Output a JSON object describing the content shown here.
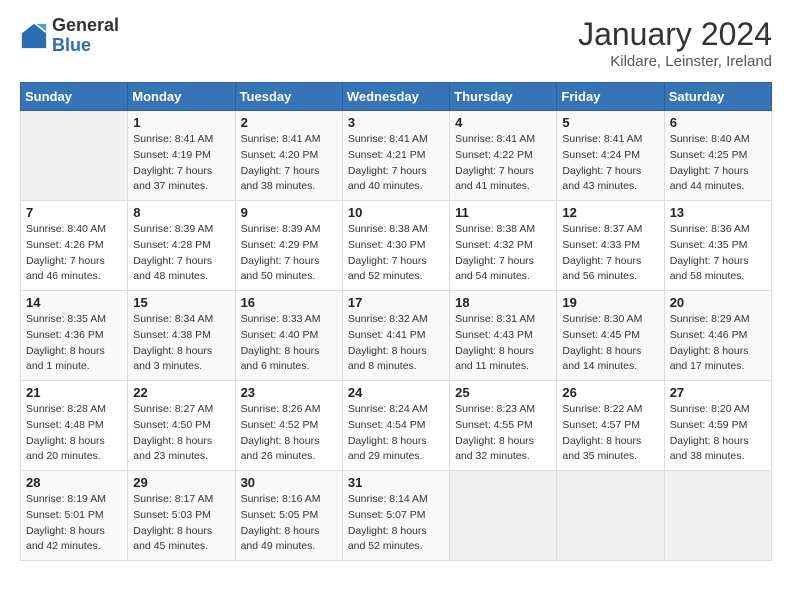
{
  "logo": {
    "general": "General",
    "blue": "Blue"
  },
  "title": "January 2024",
  "location": "Kildare, Leinster, Ireland",
  "days_of_week": [
    "Sunday",
    "Monday",
    "Tuesday",
    "Wednesday",
    "Thursday",
    "Friday",
    "Saturday"
  ],
  "weeks": [
    [
      {
        "day": null
      },
      {
        "day": 1,
        "sunrise": "8:41 AM",
        "sunset": "4:19 PM",
        "daylight": "7 hours and 37 minutes."
      },
      {
        "day": 2,
        "sunrise": "8:41 AM",
        "sunset": "4:20 PM",
        "daylight": "7 hours and 38 minutes."
      },
      {
        "day": 3,
        "sunrise": "8:41 AM",
        "sunset": "4:21 PM",
        "daylight": "7 hours and 40 minutes."
      },
      {
        "day": 4,
        "sunrise": "8:41 AM",
        "sunset": "4:22 PM",
        "daylight": "7 hours and 41 minutes."
      },
      {
        "day": 5,
        "sunrise": "8:41 AM",
        "sunset": "4:24 PM",
        "daylight": "7 hours and 43 minutes."
      },
      {
        "day": 6,
        "sunrise": "8:40 AM",
        "sunset": "4:25 PM",
        "daylight": "7 hours and 44 minutes."
      }
    ],
    [
      {
        "day": 7,
        "sunrise": "8:40 AM",
        "sunset": "4:26 PM",
        "daylight": "7 hours and 46 minutes."
      },
      {
        "day": 8,
        "sunrise": "8:39 AM",
        "sunset": "4:28 PM",
        "daylight": "7 hours and 48 minutes."
      },
      {
        "day": 9,
        "sunrise": "8:39 AM",
        "sunset": "4:29 PM",
        "daylight": "7 hours and 50 minutes."
      },
      {
        "day": 10,
        "sunrise": "8:38 AM",
        "sunset": "4:30 PM",
        "daylight": "7 hours and 52 minutes."
      },
      {
        "day": 11,
        "sunrise": "8:38 AM",
        "sunset": "4:32 PM",
        "daylight": "7 hours and 54 minutes."
      },
      {
        "day": 12,
        "sunrise": "8:37 AM",
        "sunset": "4:33 PM",
        "daylight": "7 hours and 56 minutes."
      },
      {
        "day": 13,
        "sunrise": "8:36 AM",
        "sunset": "4:35 PM",
        "daylight": "7 hours and 58 minutes."
      }
    ],
    [
      {
        "day": 14,
        "sunrise": "8:35 AM",
        "sunset": "4:36 PM",
        "daylight": "8 hours and 1 minute."
      },
      {
        "day": 15,
        "sunrise": "8:34 AM",
        "sunset": "4:38 PM",
        "daylight": "8 hours and 3 minutes."
      },
      {
        "day": 16,
        "sunrise": "8:33 AM",
        "sunset": "4:40 PM",
        "daylight": "8 hours and 6 minutes."
      },
      {
        "day": 17,
        "sunrise": "8:32 AM",
        "sunset": "4:41 PM",
        "daylight": "8 hours and 8 minutes."
      },
      {
        "day": 18,
        "sunrise": "8:31 AM",
        "sunset": "4:43 PM",
        "daylight": "8 hours and 11 minutes."
      },
      {
        "day": 19,
        "sunrise": "8:30 AM",
        "sunset": "4:45 PM",
        "daylight": "8 hours and 14 minutes."
      },
      {
        "day": 20,
        "sunrise": "8:29 AM",
        "sunset": "4:46 PM",
        "daylight": "8 hours and 17 minutes."
      }
    ],
    [
      {
        "day": 21,
        "sunrise": "8:28 AM",
        "sunset": "4:48 PM",
        "daylight": "8 hours and 20 minutes."
      },
      {
        "day": 22,
        "sunrise": "8:27 AM",
        "sunset": "4:50 PM",
        "daylight": "8 hours and 23 minutes."
      },
      {
        "day": 23,
        "sunrise": "8:26 AM",
        "sunset": "4:52 PM",
        "daylight": "8 hours and 26 minutes."
      },
      {
        "day": 24,
        "sunrise": "8:24 AM",
        "sunset": "4:54 PM",
        "daylight": "8 hours and 29 minutes."
      },
      {
        "day": 25,
        "sunrise": "8:23 AM",
        "sunset": "4:55 PM",
        "daylight": "8 hours and 32 minutes."
      },
      {
        "day": 26,
        "sunrise": "8:22 AM",
        "sunset": "4:57 PM",
        "daylight": "8 hours and 35 minutes."
      },
      {
        "day": 27,
        "sunrise": "8:20 AM",
        "sunset": "4:59 PM",
        "daylight": "8 hours and 38 minutes."
      }
    ],
    [
      {
        "day": 28,
        "sunrise": "8:19 AM",
        "sunset": "5:01 PM",
        "daylight": "8 hours and 42 minutes."
      },
      {
        "day": 29,
        "sunrise": "8:17 AM",
        "sunset": "5:03 PM",
        "daylight": "8 hours and 45 minutes."
      },
      {
        "day": 30,
        "sunrise": "8:16 AM",
        "sunset": "5:05 PM",
        "daylight": "8 hours and 49 minutes."
      },
      {
        "day": 31,
        "sunrise": "8:14 AM",
        "sunset": "5:07 PM",
        "daylight": "8 hours and 52 minutes."
      },
      {
        "day": null
      },
      {
        "day": null
      },
      {
        "day": null
      }
    ]
  ]
}
